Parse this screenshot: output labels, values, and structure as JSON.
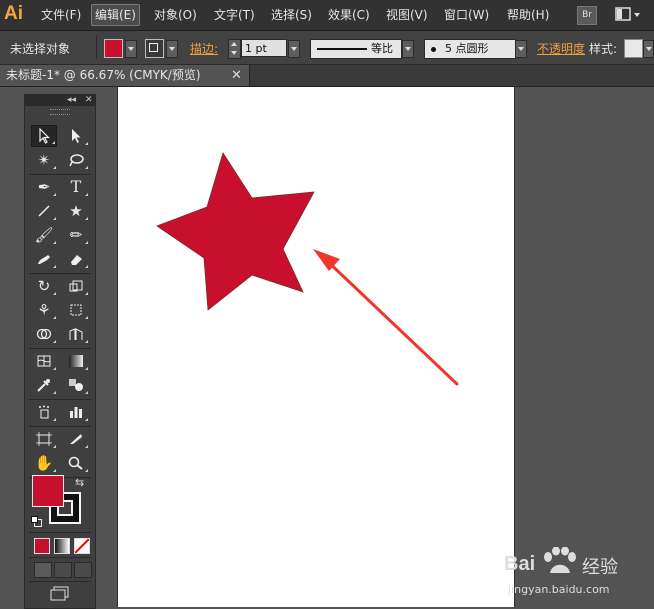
{
  "app": {
    "logo": "Ai"
  },
  "menu": {
    "items": [
      "文件(F)",
      "编辑(E)",
      "对象(O)",
      "文字(T)",
      "选择(S)",
      "效果(C)",
      "视图(V)",
      "窗口(W)",
      "帮助(H)"
    ],
    "active_index": 1,
    "bridge_label": "Br"
  },
  "control_bar": {
    "selection_status": "未选择对象",
    "fill_color": "#c8102e",
    "stroke_label": "描边:",
    "stroke_weight": "1 pt",
    "stroke_profile_label": "等比",
    "brush_label": "5 点圆形",
    "opacity_label": "不透明度",
    "style_label": "样式:"
  },
  "document": {
    "tab_title": "未标题-1* @ 66.67% (CMYK/预览)"
  },
  "canvas": {
    "star_fill": "#c8102e",
    "arrow_color": "#f0352a"
  },
  "toolbox": {
    "tools": [
      [
        "selection-tool",
        "direct-selection-tool"
      ],
      [
        "magic-wand-tool",
        "lasso-tool"
      ],
      [
        "pen-tool",
        "type-tool"
      ],
      [
        "line-segment-tool",
        "star-tool"
      ],
      [
        "paintbrush-tool",
        "pencil-tool"
      ],
      [
        "blob-brush-tool",
        "eraser-tool"
      ],
      [
        "rotate-tool",
        "scale-tool"
      ],
      [
        "width-tool",
        "free-transform-tool"
      ],
      [
        "shape-builder-tool",
        "perspective-grid-tool"
      ],
      [
        "mesh-tool",
        "gradient-tool"
      ],
      [
        "eyedropper-tool",
        "blend-tool"
      ],
      [
        "symbol-sprayer-tool",
        "column-graph-tool"
      ],
      [
        "artboard-tool",
        "slice-tool"
      ],
      [
        "hand-tool",
        "zoom-tool"
      ]
    ],
    "fill_color": "#c8102e"
  },
  "watermark": {
    "brand": "Bai",
    "brand_cn": "经验",
    "url": "jingyan.baidu.com"
  }
}
